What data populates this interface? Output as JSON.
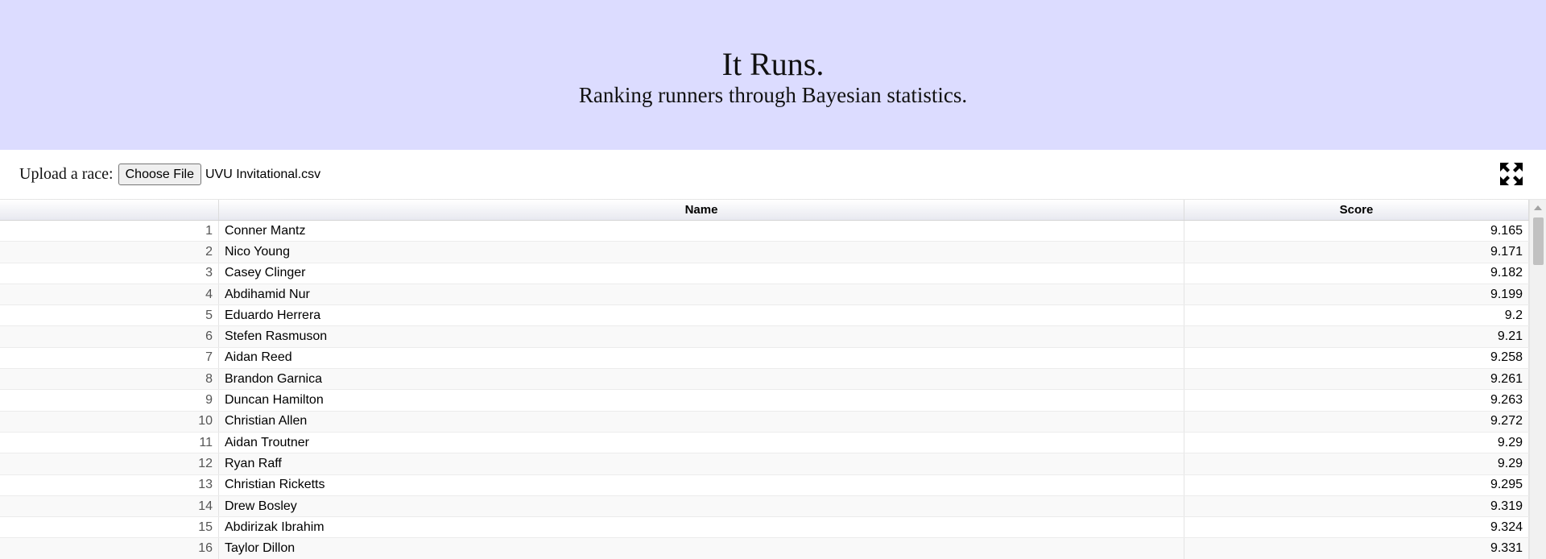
{
  "header": {
    "title": "It Runs.",
    "subtitle": "Ranking runners through Bayesian statistics."
  },
  "upload": {
    "label": "Upload a race:",
    "button_label": "Choose File",
    "file_name": "UVU Invitational.csv"
  },
  "icons": {
    "expand": "expand-arrows-icon"
  },
  "table": {
    "columns": [
      "",
      "Name",
      "Score"
    ],
    "rows": [
      {
        "rank": "1",
        "name": "Conner Mantz",
        "score": "9.165"
      },
      {
        "rank": "2",
        "name": "Nico Young",
        "score": "9.171"
      },
      {
        "rank": "3",
        "name": "Casey Clinger",
        "score": "9.182"
      },
      {
        "rank": "4",
        "name": "Abdihamid Nur",
        "score": "9.199"
      },
      {
        "rank": "5",
        "name": "Eduardo Herrera",
        "score": "9.2"
      },
      {
        "rank": "6",
        "name": "Stefen Rasmuson",
        "score": "9.21"
      },
      {
        "rank": "7",
        "name": "Aidan Reed",
        "score": "9.258"
      },
      {
        "rank": "8",
        "name": "Brandon Garnica",
        "score": "9.261"
      },
      {
        "rank": "9",
        "name": "Duncan Hamilton",
        "score": "9.263"
      },
      {
        "rank": "10",
        "name": "Christian Allen",
        "score": "9.272"
      },
      {
        "rank": "11",
        "name": "Aidan Troutner",
        "score": "9.29"
      },
      {
        "rank": "12",
        "name": "Ryan Raff",
        "score": "9.29"
      },
      {
        "rank": "13",
        "name": "Christian Ricketts",
        "score": "9.295"
      },
      {
        "rank": "14",
        "name": "Drew Bosley",
        "score": "9.319"
      },
      {
        "rank": "15",
        "name": "Abdirizak Ibrahim",
        "score": "9.324"
      },
      {
        "rank": "16",
        "name": "Taylor Dillon",
        "score": "9.331"
      }
    ]
  },
  "colors": {
    "header_bg": "#dcdcff"
  }
}
